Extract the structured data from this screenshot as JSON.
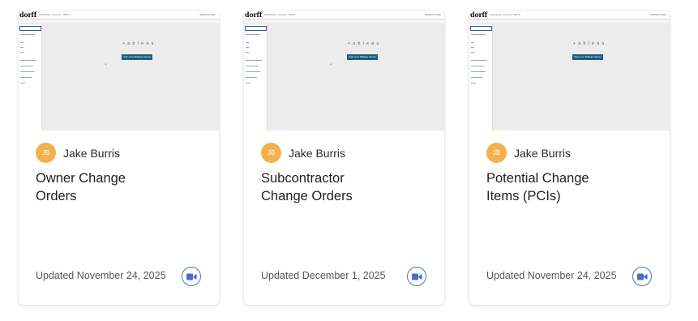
{
  "cards": [
    {
      "thumbnail": {
        "logo": "dorff",
        "window_title": "Workspace overview · BETA",
        "user": "Welcome back",
        "product_logo": "+ a b l e a u",
        "signin_label": "Sign in to Tableau Server"
      },
      "avatar_initials": "JB",
      "author": "Jake Burris",
      "title_lines": [
        "Owner Change",
        "Orders"
      ],
      "updated": "Updated November 24, 2025",
      "icon": "video-camera-icon"
    },
    {
      "thumbnail": {
        "logo": "dorff",
        "window_title": "Workspace overview · BETA",
        "user": "Welcome back",
        "product_logo": "+ a b l e a u",
        "signin_label": "Sign in to Tableau Server"
      },
      "avatar_initials": "JB",
      "author": "Jake Burris",
      "title_lines": [
        "Subcontractor",
        "Change Orders"
      ],
      "updated": "Updated December 1, 2025",
      "icon": "video-camera-icon"
    },
    {
      "thumbnail": {
        "logo": "dorff",
        "window_title": "Workspace overview · BETA",
        "user": "Welcome back",
        "product_logo": "+ a b l e a u",
        "signin_label": "Sign in to Tableau Server"
      },
      "avatar_initials": "JB",
      "author": "Jake Burris",
      "title_lines": [
        "Potential Change",
        "Items (PCIs)"
      ],
      "updated": "Updated November 24, 2025",
      "icon": "video-camera-icon"
    }
  ],
  "colors": {
    "avatar": "#f5b14c",
    "video_button": "#4a6dc8",
    "signin_button": "#1f5b7a"
  }
}
